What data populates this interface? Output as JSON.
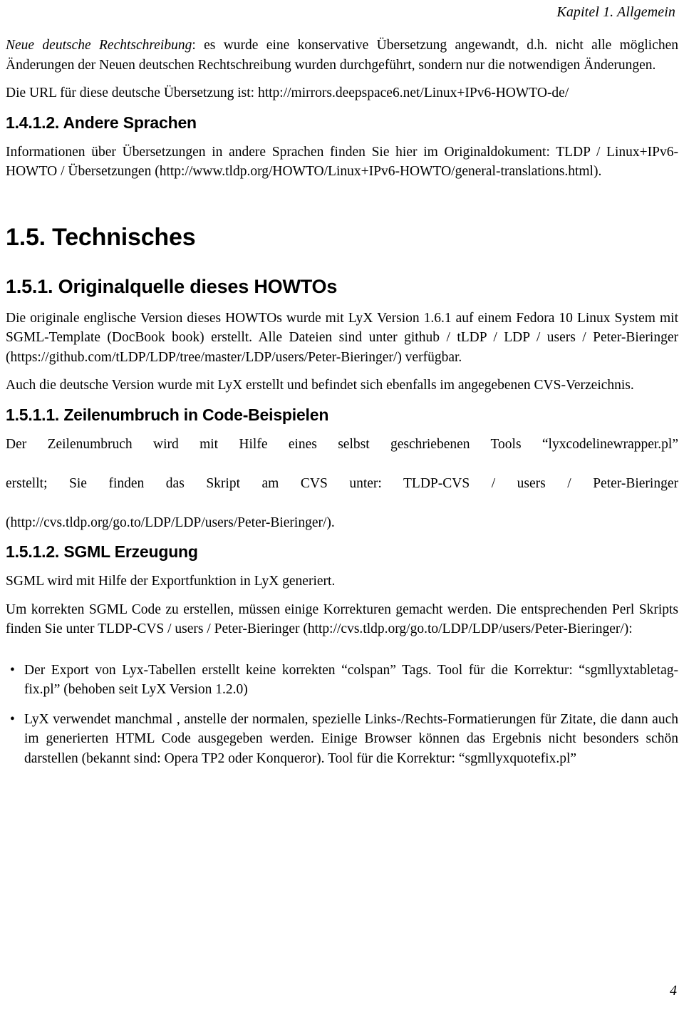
{
  "document": {
    "running_header": "Kapitel 1. Allgemein",
    "page_number": "4"
  },
  "intro": {
    "para1_lead_italic": "Neue deutsche Rechtschreibung",
    "para1_rest": ": es wurde eine konservative Übersetzung angewandt, d.h. nicht alle möglichen Änderungen der Neuen deutschen Rechtschreibung wurden durchgeführt, sondern nur die notwendigen Änderungen.",
    "para2": "Die URL für diese deutsche Übersetzung ist: http://mirrors.deepspace6.net/Linux+IPv6-HOWTO-de/"
  },
  "section_andere_sprachen": {
    "heading": "1.4.1.2. Andere Sprachen",
    "para1": "Informationen über Übersetzungen in andere Sprachen finden Sie hier im Originaldokument: TLDP / Linux+IPv6-HOWTO / Übersetzungen (http://www.tldp.org/HOWTO/Linux+IPv6-HOWTO/general-translations.html)."
  },
  "section_technisches": {
    "heading": "1.5. Technisches"
  },
  "section_originalquelle": {
    "heading": "1.5.1. Originalquelle dieses HOWTOs",
    "para1": "Die originale englische Version dieses HOWTOs wurde mit LyX Version 1.6.1 auf einem Fedora 10 Linux System mit SGML-Template (DocBook book) erstellt. Alle Dateien sind unter github / tLDP / LDP / users / Peter-Bieringer (https://github.com/tLDP/LDP/tree/master/LDP/users/Peter-Bieringer/) verfügbar.",
    "para2": "Auch die deutsche Version wurde mit LyX erstellt und befindet sich ebenfalls im angegebenen CVS-Verzeichnis."
  },
  "section_zeilenumbruch": {
    "heading": "1.5.1.1. Zeilenumbruch in Code-Beispielen",
    "para1_line1": "Der Zeilenumbruch wird mit Hilfe eines selbst geschriebenen Tools “lyxcodelinewrapper.pl”",
    "para1_line2": "erstellt; Sie finden das Skript am CVS unter: TLDP-CVS / users / Peter-Bieringer",
    "para1_line3": "(http://cvs.tldp.org/go.to/LDP/LDP/users/Peter-Bieringer/)."
  },
  "section_sgml": {
    "heading": "1.5.1.2. SGML Erzeugung",
    "para1": "SGML wird mit Hilfe der Exportfunktion in LyX generiert.",
    "para2": "Um korrekten SGML Code zu erstellen, müssen einige Korrekturen gemacht werden. Die entsprechenden Perl Skripts finden Sie unter TLDP-CVS / users / Peter-Bieringer (http://cvs.tldp.org/go.to/LDP/LDP/users/Peter-Bieringer/):",
    "bullet_marker": "•",
    "bullets": [
      "Der Export von Lyx-Tabellen erstellt keine korrekten “colspan” Tags. Tool für die Korrektur: “sgmllyxtabletag-fix.pl” (behoben seit LyX Version 1.2.0)",
      "LyX verwendet manchmal , anstelle der normalen, spezielle Links-/Rechts-Formatierungen für Zitate, die dann auch im generierten HTML Code ausgegeben werden. Einige Browser können das Ergebnis nicht besonders schön darstellen (bekannt sind: Opera TP2 oder Konqueror). Tool für die Korrektur: “sgmllyxquotefix.pl”"
    ]
  }
}
